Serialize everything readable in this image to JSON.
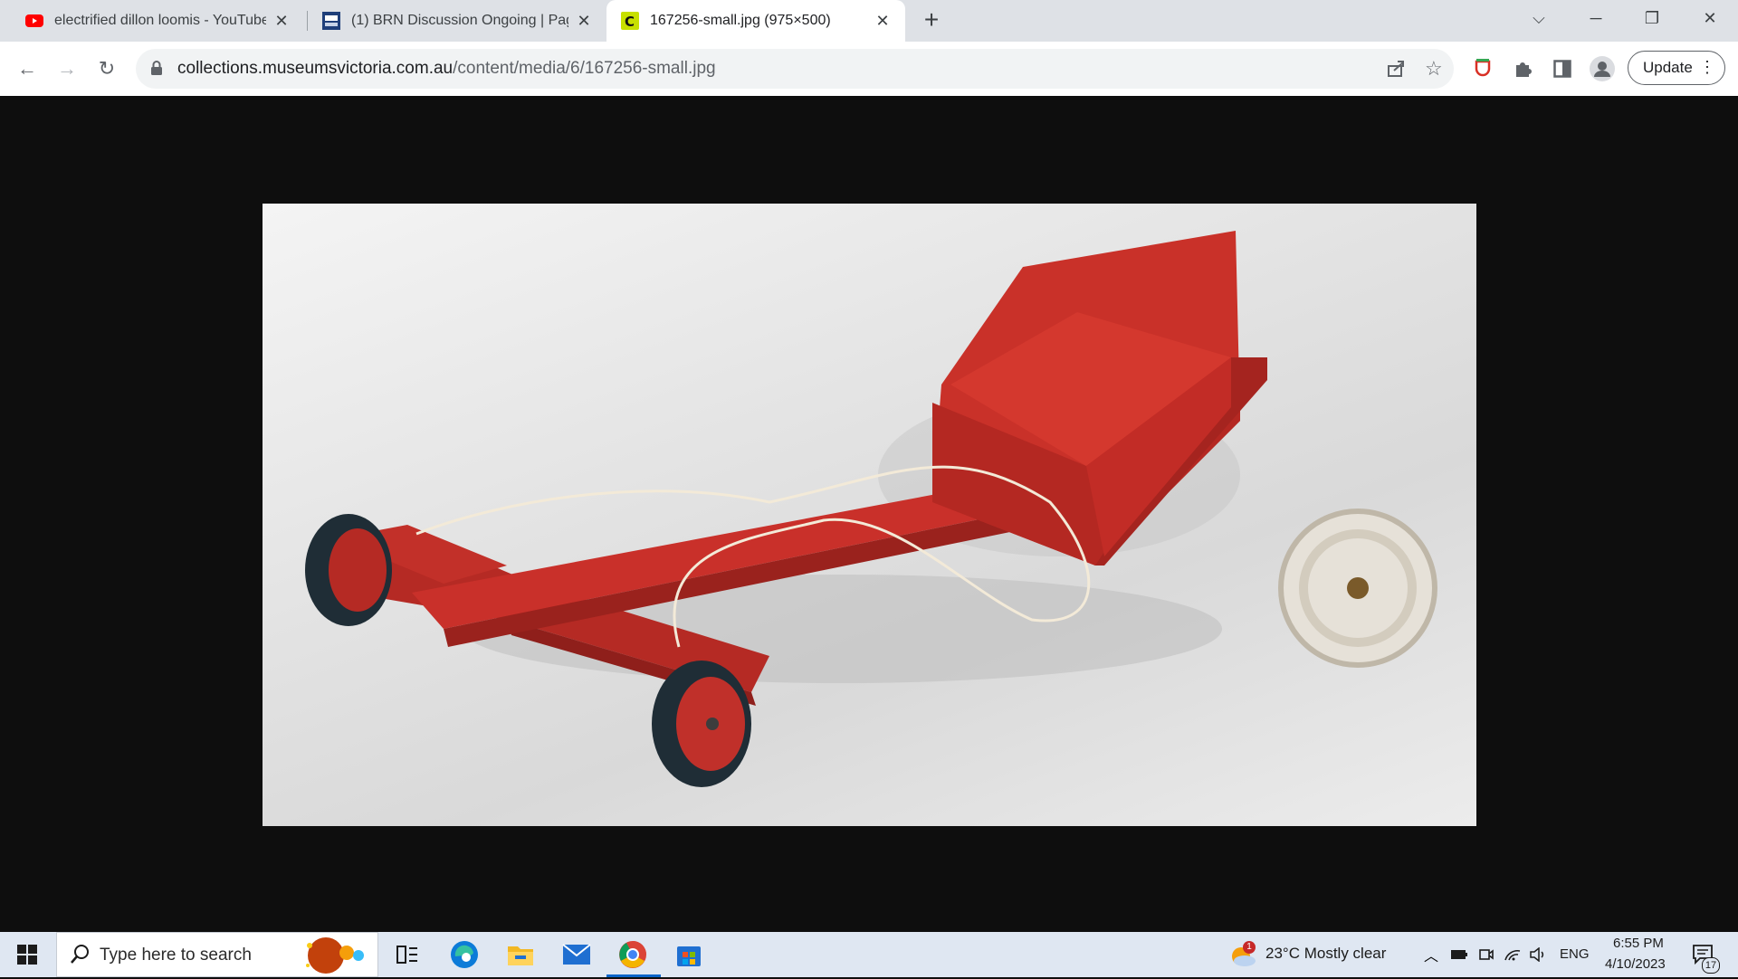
{
  "browser": {
    "tabs": [
      {
        "title": "electrified dillon loomis - YouTube",
        "favicon": "youtube-icon"
      },
      {
        "title": "(1) BRN Discussion Ongoing | Page",
        "favicon": "forum-icon"
      },
      {
        "title": "167256-small.jpg (975×500)",
        "favicon": "collections-icon"
      }
    ],
    "address": {
      "domain": "collections.museumsvictoria.com.au",
      "path": "/content/media/6/167256-small.jpg"
    },
    "update_label": "Update"
  },
  "image": {
    "description_icon": "red-toy-go-cart-photo"
  },
  "taskbar": {
    "search_placeholder": "Type here to search",
    "weather_badge": "1",
    "weather": "23°C  Mostly clear",
    "language": "ENG",
    "time": "6:55 PM",
    "date": "4/10/2023",
    "notifications": "17"
  },
  "colors": {
    "accent": "#0a64c8",
    "cart_red": "#c9302a",
    "tabstrip": "#dee1e6"
  }
}
